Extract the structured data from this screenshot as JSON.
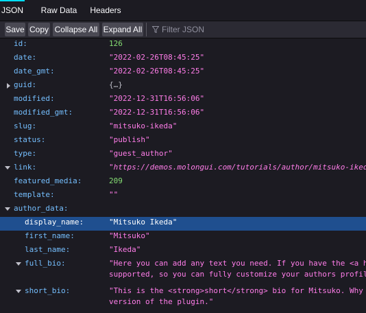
{
  "tabs": [
    {
      "label": "JSON",
      "active": true
    },
    {
      "label": "Raw Data",
      "active": false
    },
    {
      "label": "Headers",
      "active": false
    }
  ],
  "toolbar": {
    "save": "Save",
    "copy": "Copy",
    "collapse_all": "Collapse All",
    "expand_all": "Expand All",
    "filter_placeholder": "Filter JSON"
  },
  "colors": {
    "accent": "#00ddff",
    "key": "#75bfff",
    "string": "#ff7de9",
    "number": "#86de74",
    "selection": "#1f4f8f"
  },
  "rows": [
    {
      "key": "id:",
      "value": "126",
      "type": "number"
    },
    {
      "key": "date:",
      "value": "\"2022-02-26T08:45:25\"",
      "type": "string"
    },
    {
      "key": "date_gmt:",
      "value": "\"2022-02-26T08:45:25\"",
      "type": "string"
    },
    {
      "key": "guid:",
      "value": "{…}",
      "type": "object",
      "expanded": false
    },
    {
      "key": "modified:",
      "value": "\"2022-12-31T16:56:06\"",
      "type": "string"
    },
    {
      "key": "modified_gmt:",
      "value": "\"2022-12-31T16:56:06\"",
      "type": "string"
    },
    {
      "key": "slug:",
      "value": "\"mitsuko-ikeda\"",
      "type": "string"
    },
    {
      "key": "status:",
      "value": "\"publish\"",
      "type": "string"
    },
    {
      "key": "type:",
      "value": "\"guest_author\"",
      "type": "string"
    },
    {
      "key": "link:",
      "value": "\"https://demos.molongui.com/tutorials/author/mitsuko-ikeda/\"",
      "type": "url",
      "expanded": true
    },
    {
      "key": "featured_media:",
      "value": "209",
      "type": "number"
    },
    {
      "key": "template:",
      "value": "\"\"",
      "type": "string"
    },
    {
      "key": "author_data:",
      "value": "",
      "type": "object",
      "expanded": true
    },
    {
      "key": "display_name:",
      "value": "\"Mitsuko Ikeda\"",
      "type": "string",
      "selected": true
    },
    {
      "key": "first_name:",
      "value": "\"Mitsuko\"",
      "type": "string"
    },
    {
      "key": "last_name:",
      "value": "\"Ikeda\"",
      "type": "string"
    },
    {
      "key": "full_bio:",
      "value": "\"Here you can add any text you need. If you have the <a href=\\\"",
      "value2": "supported, so you can fully customize your authors profile bios",
      "type": "string",
      "expanded": true
    },
    {
      "key": "short_bio:",
      "value": "\"This is the <strong>short</strong> bio for Mitsuko. Why is thi",
      "value2": "version of the plugin.\"",
      "type": "string",
      "expanded": true
    }
  ]
}
